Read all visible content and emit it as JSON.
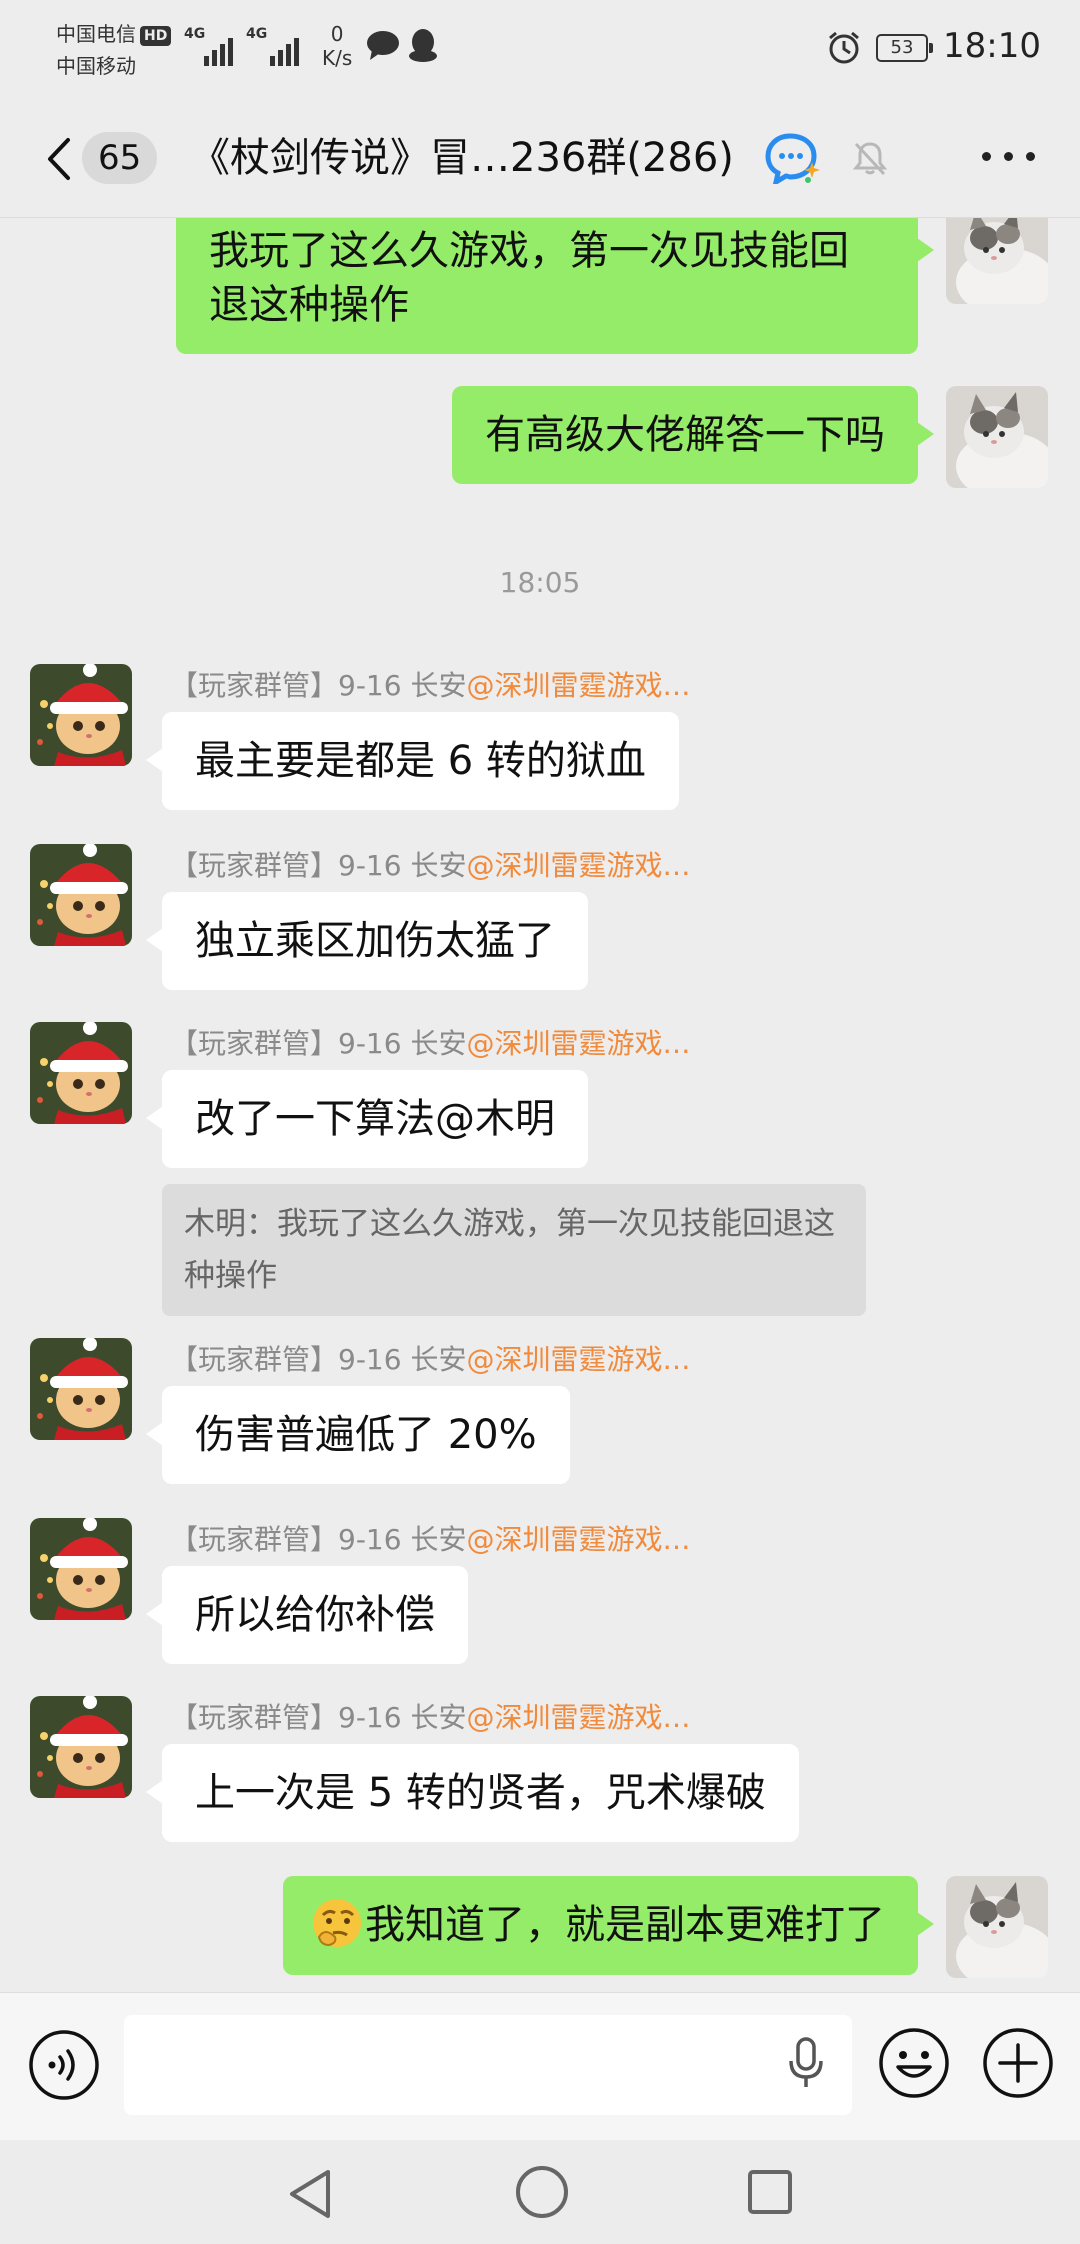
{
  "status_bar": {
    "carrier_1": "中国电信",
    "carrier_1_badge": "HD",
    "carrier_2": "中国移动",
    "network_type": "4G",
    "speed_value": "0",
    "speed_unit": "K/s",
    "battery": "53",
    "time": "18:10"
  },
  "title_bar": {
    "unread_count": "65",
    "title": "《杖剑传说》冒…236群(286)"
  },
  "messages": [
    {
      "side": "right",
      "text": "我玩了这么久游戏，第一次见技能回退这种操作"
    },
    {
      "side": "right",
      "text": "有高级大佬解答一下吗"
    },
    {
      "type": "time",
      "text": "18:05"
    },
    {
      "side": "left",
      "sender": "【玩家群管】9-16 长安",
      "mention": "@深圳雷霆游戏…",
      "text": "最主要是都是 6 转的狱血"
    },
    {
      "side": "left",
      "sender": "【玩家群管】9-16 长安",
      "mention": "@深圳雷霆游戏…",
      "text": "独立乘区加伤太猛了"
    },
    {
      "side": "left",
      "sender": "【玩家群管】9-16 长安",
      "mention": "@深圳雷霆游戏…",
      "text": "改了一下算法@木明",
      "quote": "木明：我玩了这么久游戏，第一次见技能回退这种操作"
    },
    {
      "side": "left",
      "sender": "【玩家群管】9-16 长安",
      "mention": "@深圳雷霆游戏…",
      "text": "伤害普遍低了 20%"
    },
    {
      "side": "left",
      "sender": "【玩家群管】9-16 长安",
      "mention": "@深圳雷霆游戏…",
      "text": "所以给你补偿"
    },
    {
      "side": "left",
      "sender": "【玩家群管】9-16 长安",
      "mention": "@深圳雷霆游戏…",
      "text": "上一次是 5 转的贤者，咒术爆破"
    },
    {
      "side": "right",
      "emoji": "thinking-face",
      "text": "我知道了，就是副本更难打了"
    }
  ],
  "input_bar": {
    "value": "",
    "placeholder": ""
  },
  "icons": {
    "back": "chevron-left-icon",
    "ai_assistant": "chat-bubble-sparkle-icon",
    "mute": "bell-off-icon",
    "more": "ellipsis-icon",
    "voice": "voice-wave-icon",
    "mic": "microphone-icon",
    "emoji": "smiley-icon",
    "plus": "plus-icon",
    "nav_back": "triangle-back-icon",
    "nav_home": "circle-home-icon",
    "nav_recent": "square-recent-icon"
  },
  "colors": {
    "background": "#ededed",
    "bubble_self": "#95ec69",
    "bubble_other": "#ffffff",
    "mention": "#f08a3c",
    "quote_bg": "#dcdcdc"
  }
}
